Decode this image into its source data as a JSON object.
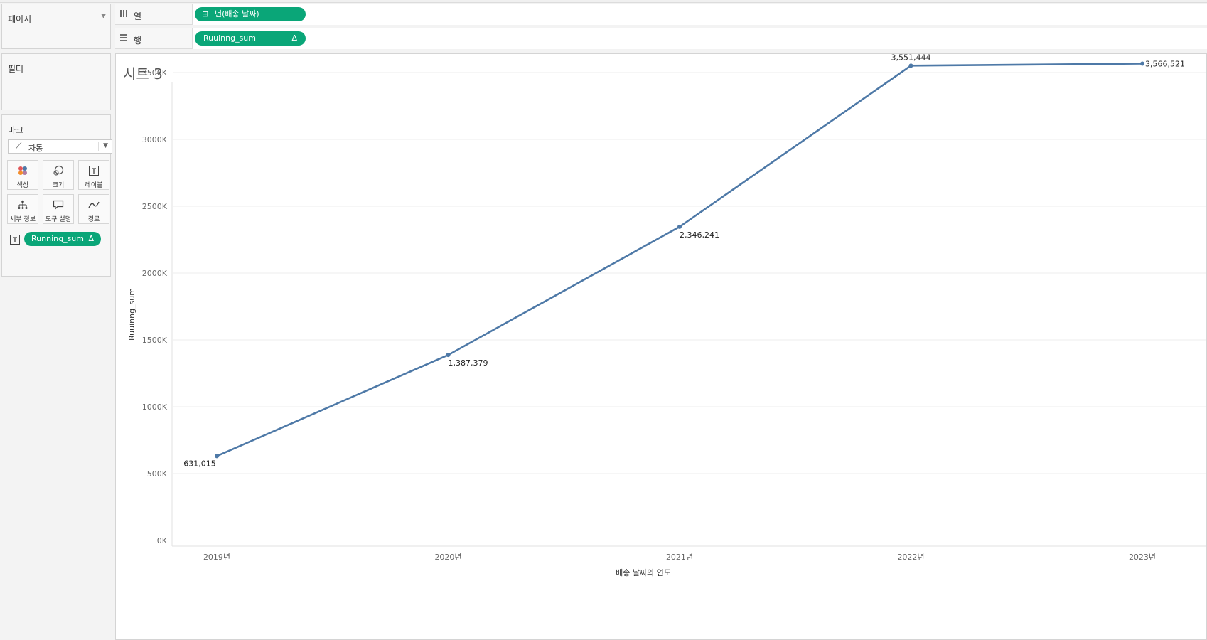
{
  "panels": {
    "pages_title": "페이지",
    "filters_title": "필터",
    "marks_title": "마크",
    "mark_type": "자동",
    "mark_buttons": [
      "색상",
      "크기",
      "레이블",
      "세부 정보",
      "도구 설명",
      "경로"
    ],
    "label_pill": "Running_sum",
    "label_pill_delta": "Δ"
  },
  "shelves": {
    "columns_label": "열",
    "columns_pill": "년(배송 날짜)",
    "rows_label": "행",
    "rows_pill": "Ruuinng_sum",
    "rows_pill_delta": "Δ"
  },
  "sheet": {
    "title": "시트 3"
  },
  "chart_data": {
    "type": "line",
    "categories": [
      "2019년",
      "2020년",
      "2021년",
      "2022년",
      "2023년"
    ],
    "values": [
      631015,
      1387379,
      2346241,
      3551444,
      3566521
    ],
    "data_labels": [
      "631,015",
      "1,387,379",
      "2,346,241",
      "3,551,444",
      "3,566,521"
    ],
    "xlabel": "배송 날짜의 연도",
    "ylabel": "Ruuinng_sum",
    "ylim": [
      0,
      3500000
    ],
    "yticks": [
      0,
      500000,
      1000000,
      1500000,
      2000000,
      2500000,
      3000000,
      3500000
    ],
    "ytick_labels": [
      "0K",
      "500K",
      "1000K",
      "1500K",
      "2000K",
      "2500K",
      "3000K",
      "3500K"
    ],
    "line_color": "#4e79a7",
    "grid": true
  },
  "colors": {
    "pill": "#0aa678",
    "line": "#4e79a7"
  }
}
